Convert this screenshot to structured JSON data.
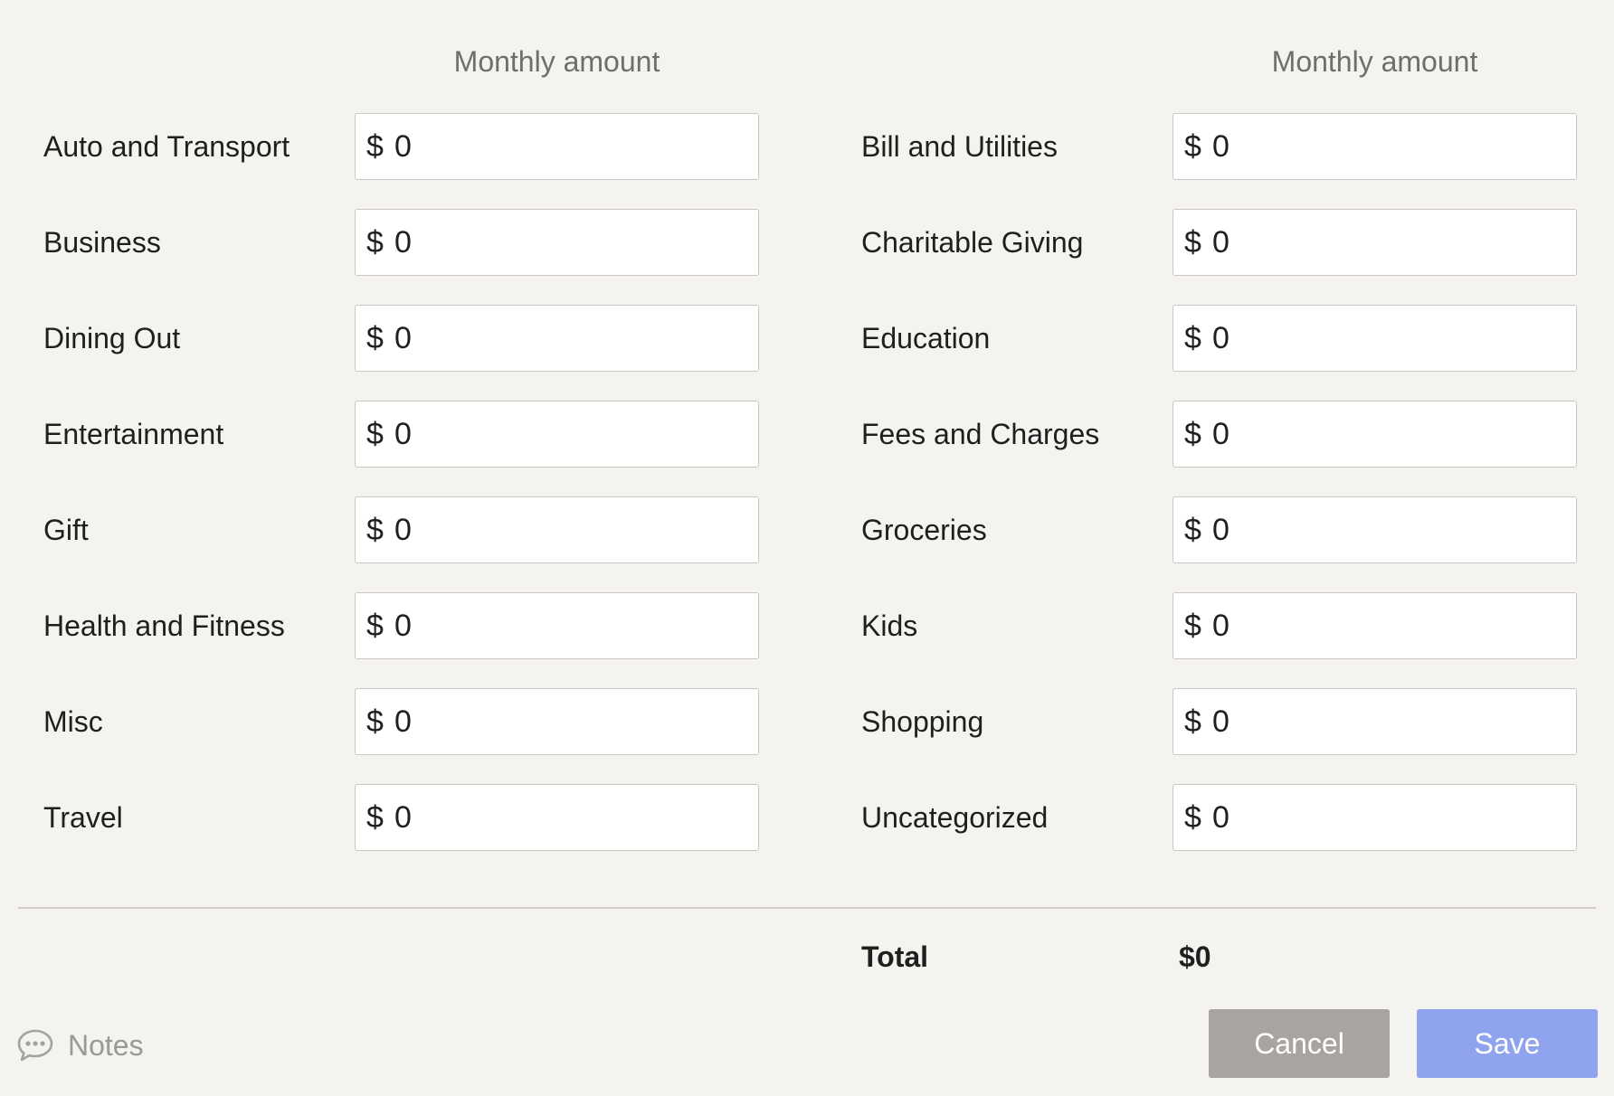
{
  "columns": [
    {
      "header": "Monthly amount",
      "rows": [
        {
          "label": "Auto and Transport",
          "currency": "$",
          "value": "0"
        },
        {
          "label": "Business",
          "currency": "$",
          "value": "0"
        },
        {
          "label": "Dining Out",
          "currency": "$",
          "value": "0"
        },
        {
          "label": "Entertainment",
          "currency": "$",
          "value": "0"
        },
        {
          "label": "Gift",
          "currency": "$",
          "value": "0"
        },
        {
          "label": "Health and Fitness",
          "currency": "$",
          "value": "0"
        },
        {
          "label": "Misc",
          "currency": "$",
          "value": "0"
        },
        {
          "label": "Travel",
          "currency": "$",
          "value": "0"
        }
      ]
    },
    {
      "header": "Monthly amount",
      "rows": [
        {
          "label": "Bill and Utilities",
          "currency": "$",
          "value": "0"
        },
        {
          "label": "Charitable Giving",
          "currency": "$",
          "value": "0"
        },
        {
          "label": "Education",
          "currency": "$",
          "value": "0"
        },
        {
          "label": "Fees and Charges",
          "currency": "$",
          "value": "0"
        },
        {
          "label": "Groceries",
          "currency": "$",
          "value": "0"
        },
        {
          "label": "Kids",
          "currency": "$",
          "value": "0"
        },
        {
          "label": "Shopping",
          "currency": "$",
          "value": "0"
        },
        {
          "label": "Uncategorized",
          "currency": "$",
          "value": "0"
        }
      ]
    }
  ],
  "total": {
    "label": "Total",
    "value": "$0"
  },
  "notes": {
    "label": "Notes",
    "icon": "speech-bubble-icon"
  },
  "buttons": {
    "cancel_label": "Cancel",
    "save_label": "Save"
  },
  "colors": {
    "background": "#f4f3ef",
    "cancel_button": "#a8a49f",
    "save_button": "#8fa3ee"
  }
}
